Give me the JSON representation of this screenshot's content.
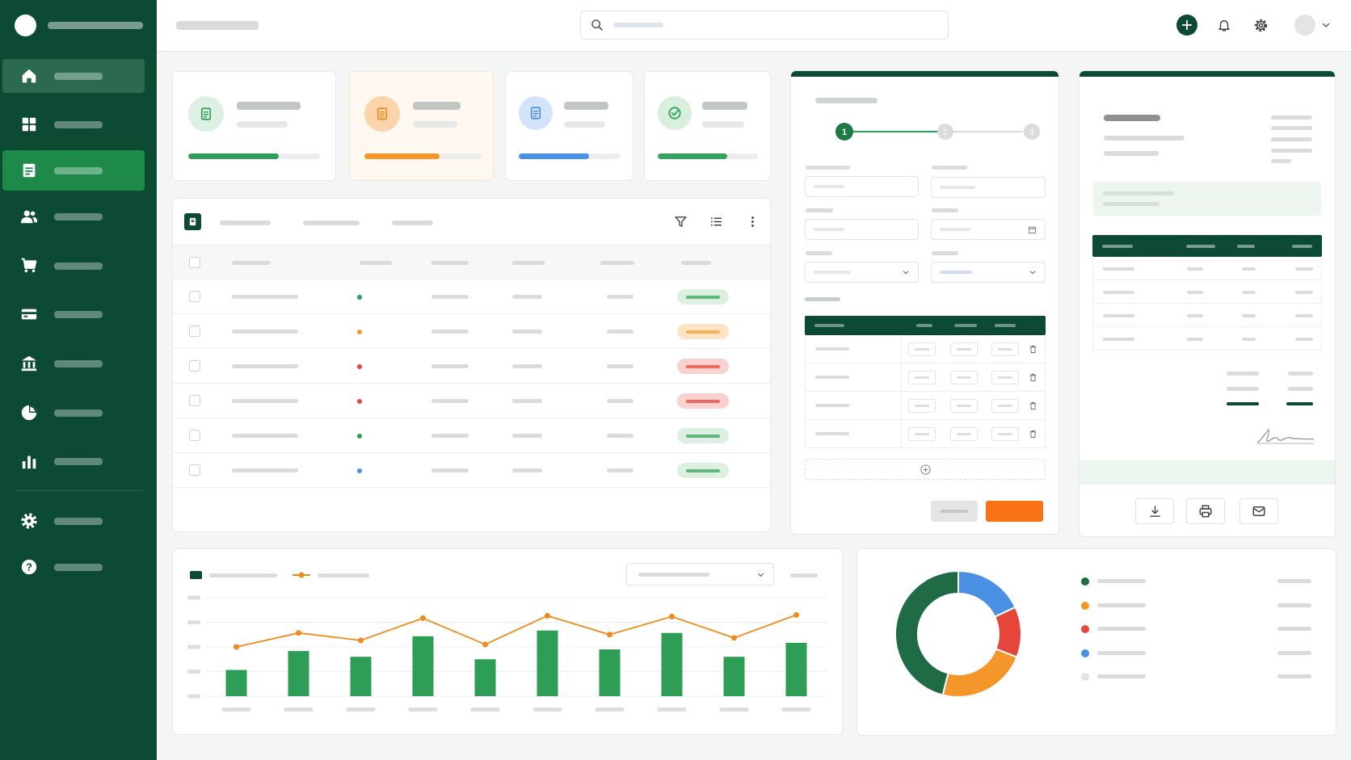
{
  "colors": {
    "sidebar_bg": "#0d4a34",
    "sidebar_active": "#1e8a4a",
    "primary_green": "#2e9e57",
    "accent_orange": "#f97316",
    "line_orange": "#f08a1c",
    "blue": "#4a90e2",
    "red": "#e5453a"
  },
  "sidebar": {
    "items": [
      {
        "icon": "home-icon",
        "state": "hover"
      },
      {
        "icon": "grid-icon"
      },
      {
        "icon": "document-icon",
        "state": "active"
      },
      {
        "icon": "users-icon"
      },
      {
        "icon": "cart-icon"
      },
      {
        "icon": "card-icon"
      },
      {
        "icon": "bank-icon"
      },
      {
        "icon": "pie-icon"
      },
      {
        "icon": "bar-chart-icon"
      },
      {
        "icon": "gear-icon"
      },
      {
        "icon": "help-icon",
        "glyph": "?"
      }
    ]
  },
  "topbar": {
    "icons": [
      "search-icon",
      "plus-icon",
      "bell-icon",
      "gear-icon",
      "avatar",
      "chevron-down-icon"
    ]
  },
  "stats": [
    {
      "icon": "document-icon",
      "color": "#2e9e57",
      "progress": 0.69
    },
    {
      "icon": "document-icon",
      "color": "#f5962a",
      "progress": 0.64,
      "highlight": true
    },
    {
      "icon": "document-icon",
      "color": "#4a90e2",
      "progress": 0.69
    },
    {
      "icon": "check-circle-icon",
      "color": "#34a35f",
      "progress": 0.69
    }
  ],
  "table": {
    "toolbar_icons": [
      "filter-icon",
      "list-icon",
      "more-vertical-icon"
    ],
    "rows": [
      {
        "status": "green"
      },
      {
        "status": "orange"
      },
      {
        "status": "red"
      },
      {
        "status": "red"
      },
      {
        "status": "green"
      },
      {
        "status": "blue"
      }
    ]
  },
  "form": {
    "stepper": {
      "steps": [
        "1",
        "2",
        "3"
      ],
      "active_step": 1
    },
    "line_item_rows": 4
  },
  "invoice": {
    "rows": 4,
    "actions": [
      "download-icon",
      "printer-icon",
      "mail-icon"
    ]
  },
  "chart_data": [
    {
      "type": "bar",
      "series": [
        {
          "type": "bar",
          "color": "#2e9e57",
          "values": [
            32,
            55,
            48,
            73,
            45,
            80,
            57,
            77,
            48,
            65
          ]
        },
        {
          "type": "line",
          "color": "#f08a1c",
          "values": [
            60,
            77,
            68,
            95,
            63,
            98,
            75,
            97,
            71,
            99
          ]
        }
      ],
      "categories_count": 10,
      "ylim": [
        0,
        120
      ],
      "legend": "top-left",
      "grid": true
    },
    {
      "type": "pie",
      "donut": true,
      "slices": [
        {
          "color": "#4a90e2",
          "value": 18
        },
        {
          "color": "#e5453a",
          "value": 13
        },
        {
          "color": "#f5962a",
          "value": 23
        },
        {
          "color": "#1e6b45",
          "value": 46
        }
      ],
      "legend_colors": [
        "#1e6b45",
        "#f5962a",
        "#e5453a",
        "#4a90e2",
        "#e3e5e4"
      ]
    }
  ]
}
